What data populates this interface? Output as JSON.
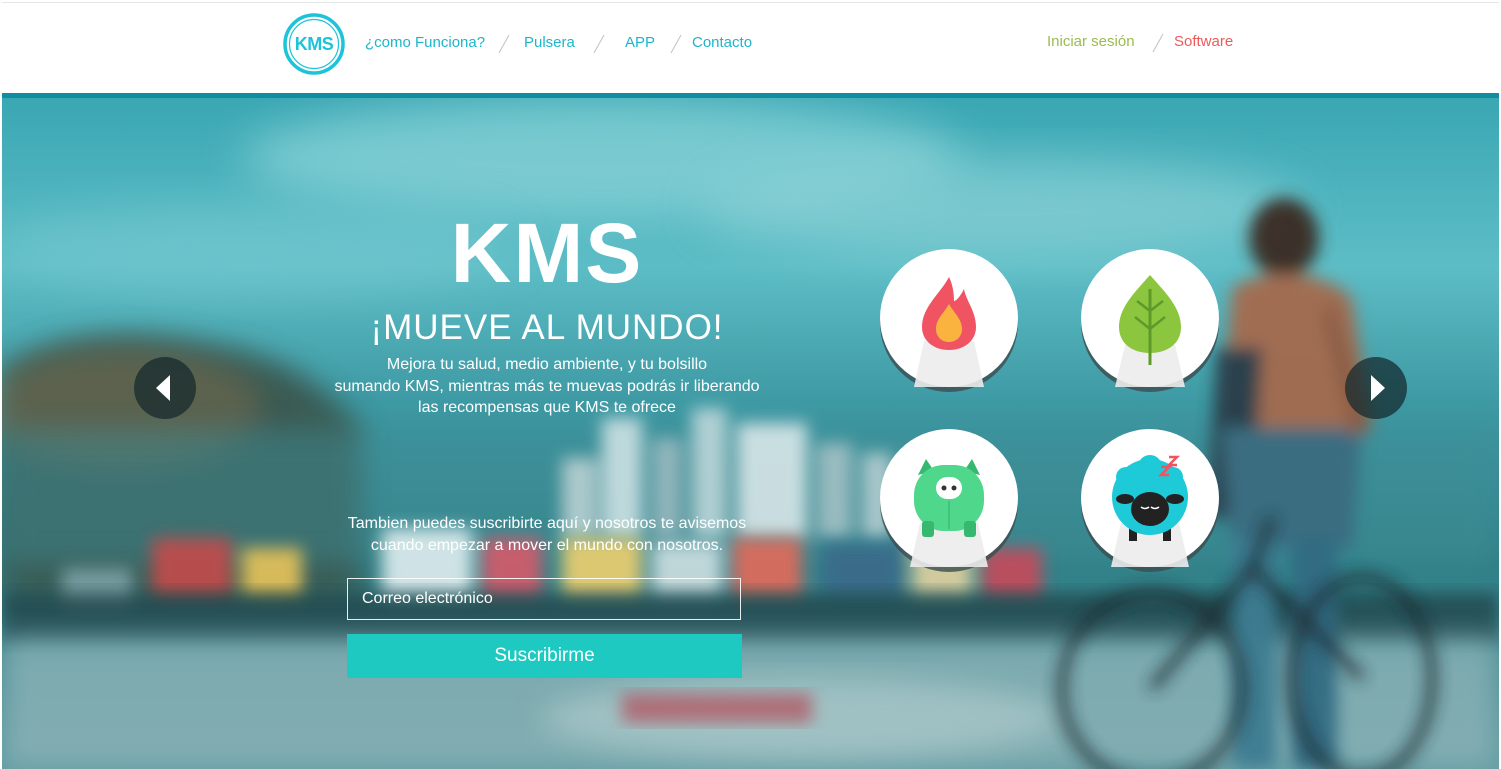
{
  "header": {
    "logo_text": "KMS",
    "nav": [
      {
        "label": "¿como Funciona?"
      },
      {
        "label": "Pulsera"
      },
      {
        "label": "APP"
      },
      {
        "label": "Contacto"
      }
    ],
    "login_label": "Iniciar sesión",
    "software_label": "Software"
  },
  "hero": {
    "brand": "KMS",
    "headline": "¡MUEVE AL MUNDO!",
    "description_lines": [
      "Mejora tu salud, medio ambiente, y tu bolsillo",
      "sumando KMS, mientras más te muevas podrás ir liberando",
      "las recompensas que KMS te ofrece"
    ],
    "subscribe_lines": [
      "Tambien puedes suscribirte aquí y nosotros te avisemos",
      "cuando empezar a mover el mundo con nosotros."
    ],
    "email_placeholder": "Correo electrónico",
    "subscribe_label": "Suscribirme"
  },
  "badges": [
    {
      "icon": "flame-icon"
    },
    {
      "icon": "leaf-icon"
    },
    {
      "icon": "piggy-bank-icon"
    },
    {
      "icon": "sleeping-sheep-icon"
    }
  ],
  "colors": {
    "brand_cyan": "#1cb6cc",
    "header_bar": "#0e8ea0",
    "login_green": "#9bbb4e",
    "software_red": "#ee5a5a",
    "subscribe_button": "#1ec9c2",
    "flame": "#f05462",
    "leaf": "#8cc63e",
    "pig": "#4fd88c",
    "sheep": "#1ec9d8"
  }
}
